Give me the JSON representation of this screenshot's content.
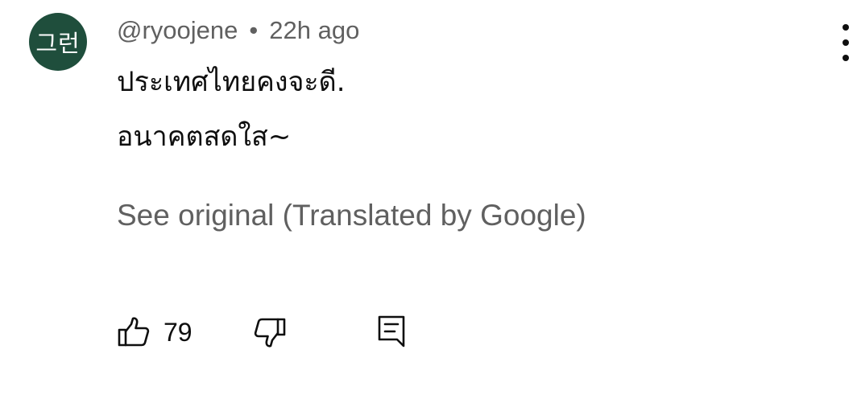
{
  "comment": {
    "avatar_text": "그런",
    "avatar_color": "#1f4e3c",
    "author": "@ryoojene",
    "separator": "•",
    "timestamp": "22h ago",
    "text_lines": [
      "ประเทศไทยคงจะดี.",
      "อนาคตสดใส~"
    ],
    "see_original_label": "See original (Translated by Google)",
    "like_count": "79"
  },
  "icons": {
    "more": "more-vertical-icon",
    "like": "thumbs-up-icon",
    "dislike": "thumbs-down-icon",
    "reply": "reply-comment-icon"
  }
}
